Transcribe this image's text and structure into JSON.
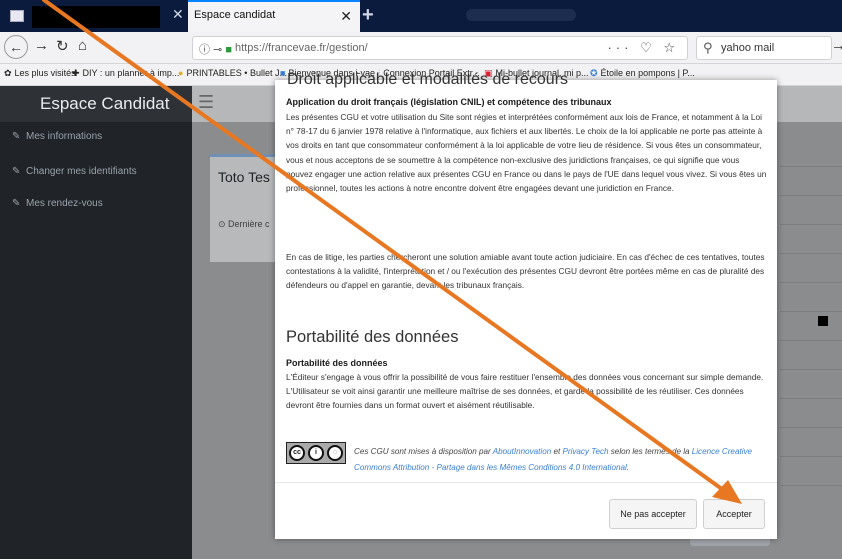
{
  "browser": {
    "active_tab_title": "Espace candidat",
    "url": "https://francevae.fr/gestion/",
    "search_value": "yahoo mail",
    "bookmarks": [
      "Les plus visités",
      "DIY : un planner à imp...",
      "PRINTABLES • Bullet J...",
      "Bienvenue dans i-vae",
      "Connexion Portail Extr...",
      "Mi-bullet journal, mi p...",
      "Étoile en pompons | P..."
    ]
  },
  "app": {
    "brand": "Espace Candidat",
    "sidebar": [
      {
        "label": "Mes informations"
      },
      {
        "label": "Changer mes identifiants"
      },
      {
        "label": "Mes rendez-vous"
      }
    ],
    "card_name": "Toto Tes",
    "card_meta": "Dernière c"
  },
  "modal": {
    "top_heading": "Droit applicable et modalités de recours",
    "s1_title": "Application du droit français (législation CNIL) et compétence des tribunaux",
    "s1_p1": "Les présentes CGU et votre utilisation du Site sont régies et interprétées conformément aux lois de France, et notamment à la Loi n° 78-17 du 6 janvier 1978 relative à l'informatique, aux fichiers et aux libertés. Le choix de la loi applicable ne porte pas atteinte à vos droits en tant que consommateur conformément à la loi applicable de votre lieu de résidence. Si vous êtes un consommateur, vous et nous acceptons de se soumettre à la compétence non-exclusive des juridictions françaises, ce qui signifie que vous pouvez engager une action relative aux présentes CGU en France ou dans le pays de l'UE dans lequel vous vivez. Si vous êtes un professionnel, toutes les actions à notre encontre doivent être engagées devant une juridiction en France.",
    "s1_p2": "En cas de litige, les parties chercheront une solution amiable avant toute action judiciaire. En cas d'échec de ces tentatives, toutes contestations à la validité, l'interprétation et / ou l'exécution des présentes CGU devront être portées même en cas de pluralité des défendeurs ou d'appel en garantie, devant les tribunaux français.",
    "s2_heading": "Portabilité des données",
    "s2_title": "Portabilité des données",
    "s2_p": "L'Éditeur s'engage à vous offrir la possibilité de vous faire restituer l'ensemble des données vous concernant sur simple demande. L'Utilisateur se voit ainsi garantir une meilleure maîtrise de ses données, et garde la possibilité de les réutiliser. Ces données devront être fournies dans un format ouvert et aisément réutilisable.",
    "cc_before": "Ces CGU sont mises à disposition par ",
    "cc_link1": "AboutInnovation",
    "cc_and": " et ",
    "cc_link2": "Privacy Tech",
    "cc_mid": " selon les termes de la ",
    "cc_link3": "Licence Creative Commons Attribution - Partage dans les Mêmes Conditions 4.0 International",
    "cc_end": ".",
    "btn_decline": "Ne pas accepter",
    "btn_accept": "Accepter"
  },
  "colors": {
    "arrow": "#e87722",
    "tabbar": "#0b1b3d",
    "sidebar": "#202428",
    "link": "#3a7fd5"
  },
  "icons": [
    "menu-icon",
    "back-icon",
    "forward-icon",
    "reload-icon",
    "home-icon",
    "lock-icon",
    "bookmark-star-icon",
    "search-icon",
    "cc-license-icon"
  ]
}
